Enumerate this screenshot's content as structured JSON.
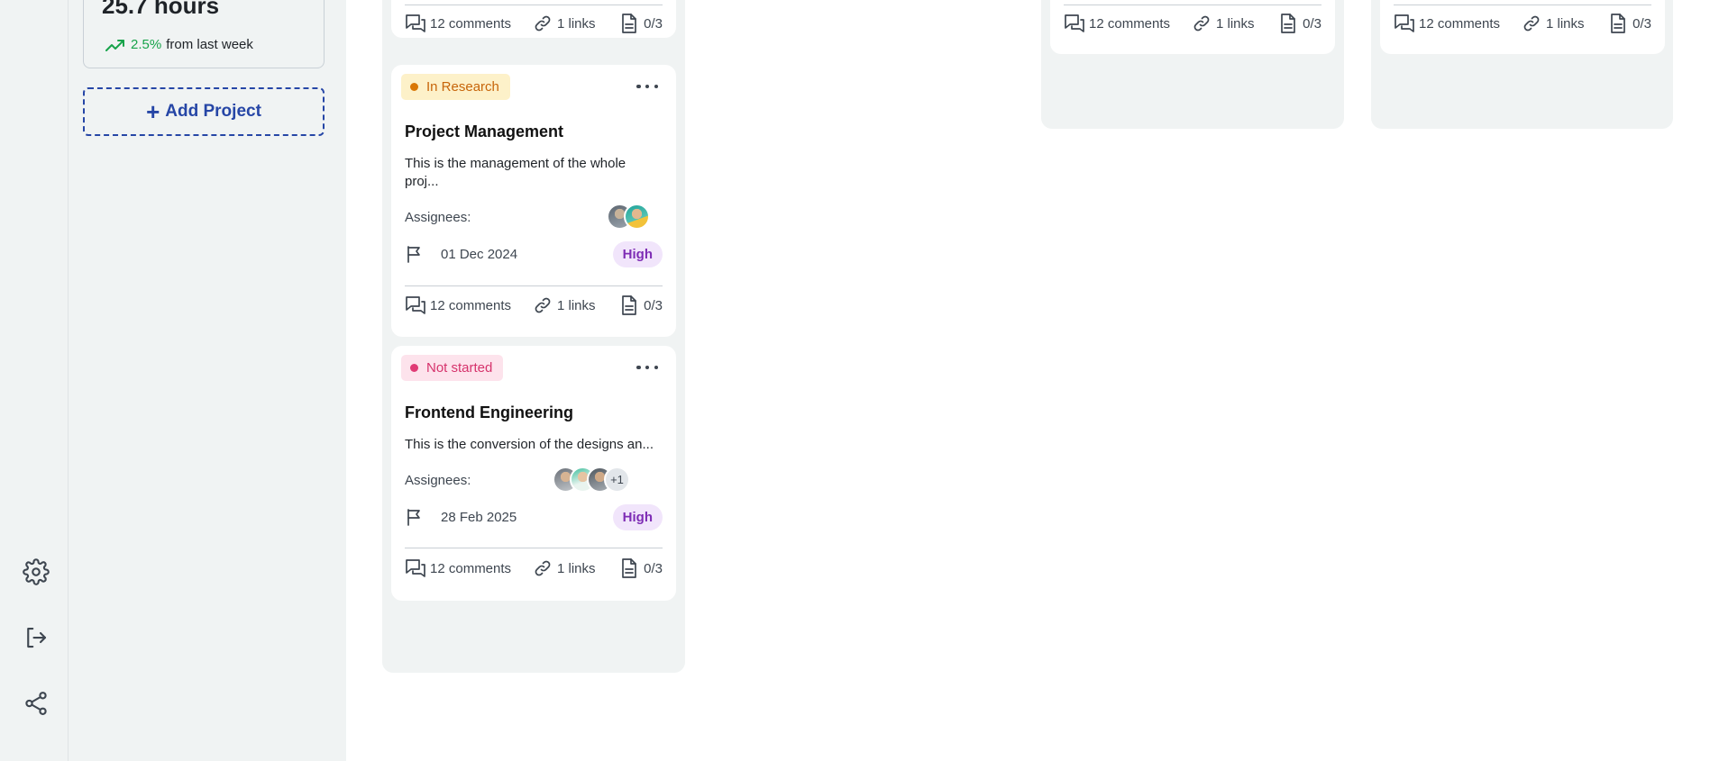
{
  "stats": {
    "value": "25.7 hours",
    "trend_pct": "2.5%",
    "trend_note": "from last week",
    "trend_icon": "trend-up-icon",
    "trend_color": "#17a34a"
  },
  "sidebar": {
    "add_project_plus": "+",
    "add_project_label": "Add Project",
    "accent_color": "#2646a6"
  },
  "rail": {
    "icons": [
      "settings-icon",
      "logout-icon",
      "share-icon"
    ]
  },
  "cards": [
    {
      "footer": {
        "comments": "12 comments",
        "links": "1 links",
        "files": "0/3"
      }
    },
    {
      "status": "In Research",
      "title": "Project Management",
      "description": "This is the management of the whole proj...",
      "assignees_label": "Assignees:",
      "due_date": "01 Dec 2024",
      "priority": "High",
      "footer": {
        "comments": "12 comments",
        "links": "1 links",
        "files": "0/3"
      }
    },
    {
      "status": "Not started",
      "title": "Frontend Engineering",
      "description": "This is the conversion of the designs an...",
      "assignees_label": "Assignees:",
      "assignees_more": "+1",
      "due_date": "28 Feb 2025",
      "priority": "High",
      "footer": {
        "comments": "12 comments",
        "links": "1 links",
        "files": "0/3"
      }
    },
    {
      "footer": {
        "comments": "12 comments",
        "links": "1 links",
        "files": "0/3"
      }
    },
    {
      "footer": {
        "comments": "12 comments",
        "links": "1 links",
        "files": "0/3"
      }
    }
  ],
  "colors": {
    "status_research": "#c7650a",
    "status_not_started": "#d6336c",
    "priority_high": "#7e2db5"
  }
}
